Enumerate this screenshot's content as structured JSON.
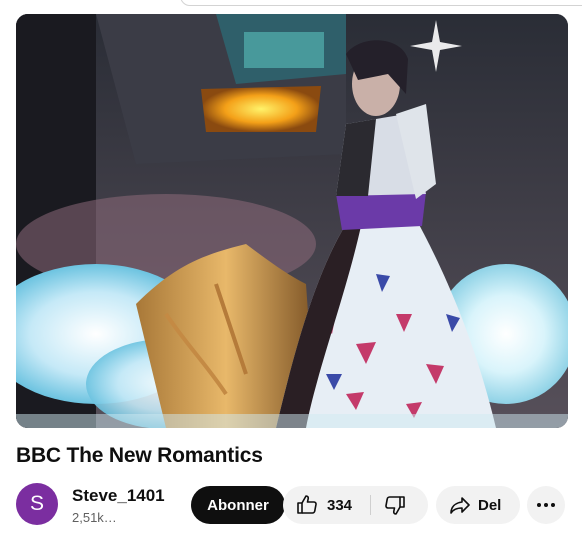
{
  "video": {
    "title": "BBC The New Romantics"
  },
  "channel": {
    "name": "Steve_1401",
    "avatar_letter": "S",
    "subscribers": "2,51k…"
  },
  "actions": {
    "subscribe_label": "Abonner",
    "like_count": "334",
    "share_label": "Del"
  },
  "icons": {
    "like": "thumbs-up-icon",
    "dislike": "thumbs-down-icon",
    "share": "share-arrow-icon",
    "more": "more-horizontal-icon"
  },
  "colors": {
    "avatar": "#7b2ea0",
    "subscribe_bg": "#0f0f0f",
    "pill_bg": "#f2f2f2"
  }
}
